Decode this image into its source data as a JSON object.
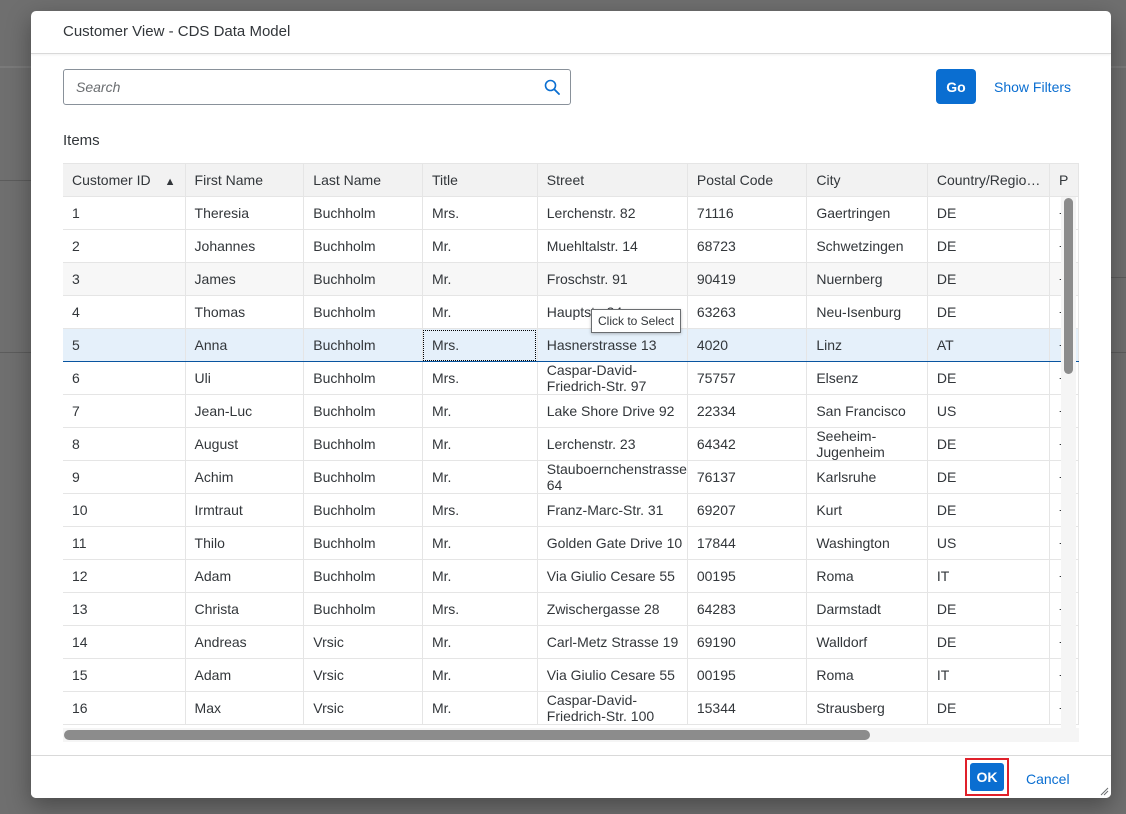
{
  "dialog": {
    "title": "Customer View - CDS Data Model"
  },
  "search": {
    "placeholder": "Search",
    "value": ""
  },
  "toolbar": {
    "go_label": "Go",
    "show_filters_label": "Show Filters"
  },
  "items_title": "Items",
  "table": {
    "columns": [
      "Customer ID",
      "First Name",
      "Last Name",
      "Title",
      "Street",
      "Postal Code",
      "City",
      "Country/Regio…",
      "P"
    ],
    "rows": [
      {
        "id": "1",
        "first": "Theresia",
        "last": "Buchholm",
        "title": "Mrs.",
        "street": "Lerchenstr. 82",
        "postal": "71116",
        "city": "Gaertringen",
        "country": "DE",
        "extra": "+"
      },
      {
        "id": "2",
        "first": "Johannes",
        "last": "Buchholm",
        "title": "Mr.",
        "street": "Muehltalstr. 14",
        "postal": "68723",
        "city": "Schwetzingen",
        "country": "DE",
        "extra": "+"
      },
      {
        "id": "3",
        "first": "James",
        "last": "Buchholm",
        "title": "Mr.",
        "street": "Froschstr. 91",
        "postal": "90419",
        "city": "Nuernberg",
        "country": "DE",
        "extra": "+"
      },
      {
        "id": "4",
        "first": "Thomas",
        "last": "Buchholm",
        "title": "Mr.",
        "street": "Hauptstr. 34",
        "postal": "63263",
        "city": "Neu-Isenburg",
        "country": "DE",
        "extra": "+"
      },
      {
        "id": "5",
        "first": "Anna",
        "last": "Buchholm",
        "title": "Mrs.",
        "street": "Hasnerstrasse 13",
        "postal": "4020",
        "city": "Linz",
        "country": "AT",
        "extra": "+"
      },
      {
        "id": "6",
        "first": "Uli",
        "last": "Buchholm",
        "title": "Mrs.",
        "street": "Caspar-David-Friedrich-Str. 97",
        "postal": "75757",
        "city": "Elsenz",
        "country": "DE",
        "extra": "+"
      },
      {
        "id": "7",
        "first": "Jean-Luc",
        "last": "Buchholm",
        "title": "Mr.",
        "street": "Lake Shore Drive 92",
        "postal": "22334",
        "city": "San Francisco",
        "country": "US",
        "extra": "+"
      },
      {
        "id": "8",
        "first": "August",
        "last": "Buchholm",
        "title": "Mr.",
        "street": "Lerchenstr. 23",
        "postal": "64342",
        "city": "Seeheim-Jugenheim",
        "country": "DE",
        "extra": "+"
      },
      {
        "id": "9",
        "first": "Achim",
        "last": "Buchholm",
        "title": "Mr.",
        "street": "Stauboernchenstrasse 64",
        "postal": "76137",
        "city": "Karlsruhe",
        "country": "DE",
        "extra": "+"
      },
      {
        "id": "10",
        "first": "Irmtraut",
        "last": "Buchholm",
        "title": "Mrs.",
        "street": "Franz-Marc-Str. 31",
        "postal": "69207",
        "city": "Kurt",
        "country": "DE",
        "extra": "+"
      },
      {
        "id": "11",
        "first": "Thilo",
        "last": "Buchholm",
        "title": "Mr.",
        "street": "Golden Gate Drive 10",
        "postal": "17844",
        "city": "Washington",
        "country": "US",
        "extra": "+"
      },
      {
        "id": "12",
        "first": "Adam",
        "last": "Buchholm",
        "title": "Mr.",
        "street": "Via Giulio Cesare 55",
        "postal": "00195",
        "city": "Roma",
        "country": "IT",
        "extra": "+"
      },
      {
        "id": "13",
        "first": "Christa",
        "last": "Buchholm",
        "title": "Mrs.",
        "street": "Zwischergasse 28",
        "postal": "64283",
        "city": "Darmstadt",
        "country": "DE",
        "extra": "+"
      },
      {
        "id": "14",
        "first": "Andreas",
        "last": "Vrsic",
        "title": "Mr.",
        "street": "Carl-Metz Strasse 19",
        "postal": "69190",
        "city": "Walldorf",
        "country": "DE",
        "extra": "+"
      },
      {
        "id": "15",
        "first": "Adam",
        "last": "Vrsic",
        "title": "Mr.",
        "street": "Via Giulio Cesare 55",
        "postal": "00195",
        "city": "Roma",
        "country": "IT",
        "extra": "+"
      },
      {
        "id": "16",
        "first": "Max",
        "last": "Vrsic",
        "title": "Mr.",
        "street": "Caspar-David-Friedrich-Str. 100",
        "postal": "15344",
        "city": "Strausberg",
        "country": "DE",
        "extra": "+"
      }
    ]
  },
  "tooltip": {
    "text": "Click to Select"
  },
  "footer": {
    "ok_label": "OK",
    "cancel_label": "Cancel"
  },
  "colors": {
    "accent": "#0a6ed1",
    "highlight_outline": "#e0202a",
    "selected_row": "#e5f0fa"
  }
}
